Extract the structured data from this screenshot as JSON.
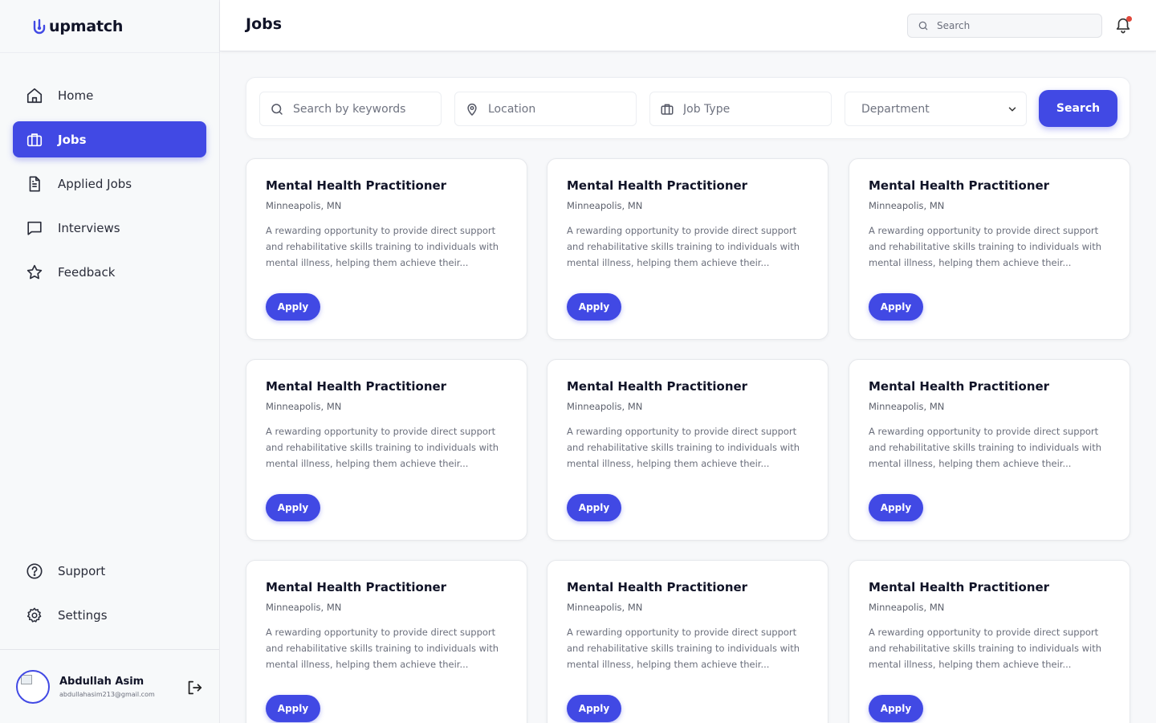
{
  "brand": {
    "name": "upmatch"
  },
  "nav": {
    "items": [
      {
        "label": "Home",
        "icon": "home-icon"
      },
      {
        "label": "Jobs",
        "icon": "briefcase-icon",
        "active": true
      },
      {
        "label": "Applied Jobs",
        "icon": "document-icon"
      },
      {
        "label": "Interviews",
        "icon": "chat-icon"
      },
      {
        "label": "Feedback",
        "icon": "star-icon"
      }
    ],
    "bottom": [
      {
        "label": "Support",
        "icon": "help-icon"
      },
      {
        "label": "Settings",
        "icon": "gear-icon"
      }
    ]
  },
  "user": {
    "name": "Abdullah Asim",
    "email": "abdullahasim213@gmail.com"
  },
  "header": {
    "title": "Jobs",
    "search_placeholder": "Search"
  },
  "filters": {
    "keywords_placeholder": "Search by keywords",
    "location_placeholder": "Location",
    "job_type_placeholder": "Job Type",
    "department_value": "Department",
    "search_label": "Search"
  },
  "colors": {
    "accent": "#4149e4",
    "notification": "#e0483b"
  },
  "jobs": [
    {
      "title": "Mental Health Practitioner",
      "location": "Minneapolis, MN",
      "description": "A rewarding opportunity to provide direct support and rehabilitative skills training to individuals with mental illness, helping them achieve their...",
      "apply_label": "Apply"
    },
    {
      "title": "Mental Health Practitioner",
      "location": "Minneapolis, MN",
      "description": "A rewarding opportunity to provide direct support and rehabilitative skills training to individuals with mental illness, helping them achieve their...",
      "apply_label": "Apply"
    },
    {
      "title": "Mental Health Practitioner",
      "location": "Minneapolis, MN",
      "description": "A rewarding opportunity to provide direct support and rehabilitative skills training to individuals with mental illness, helping them achieve their...",
      "apply_label": "Apply"
    },
    {
      "title": "Mental Health Practitioner",
      "location": "Minneapolis, MN",
      "description": "A rewarding opportunity to provide direct support and rehabilitative skills training to individuals with mental illness, helping them achieve their...",
      "apply_label": "Apply"
    },
    {
      "title": "Mental Health Practitioner",
      "location": "Minneapolis, MN",
      "description": "A rewarding opportunity to provide direct support and rehabilitative skills training to individuals with mental illness, helping them achieve their...",
      "apply_label": "Apply"
    },
    {
      "title": "Mental Health Practitioner",
      "location": "Minneapolis, MN",
      "description": "A rewarding opportunity to provide direct support and rehabilitative skills training to individuals with mental illness, helping them achieve their...",
      "apply_label": "Apply"
    },
    {
      "title": "Mental Health Practitioner",
      "location": "Minneapolis, MN",
      "description": "A rewarding opportunity to provide direct support and rehabilitative skills training to individuals with mental illness, helping them achieve their...",
      "apply_label": "Apply"
    },
    {
      "title": "Mental Health Practitioner",
      "location": "Minneapolis, MN",
      "description": "A rewarding opportunity to provide direct support and rehabilitative skills training to individuals with mental illness, helping them achieve their...",
      "apply_label": "Apply"
    },
    {
      "title": "Mental Health Practitioner",
      "location": "Minneapolis, MN",
      "description": "A rewarding opportunity to provide direct support and rehabilitative skills training to individuals with mental illness, helping them achieve their...",
      "apply_label": "Apply"
    }
  ]
}
